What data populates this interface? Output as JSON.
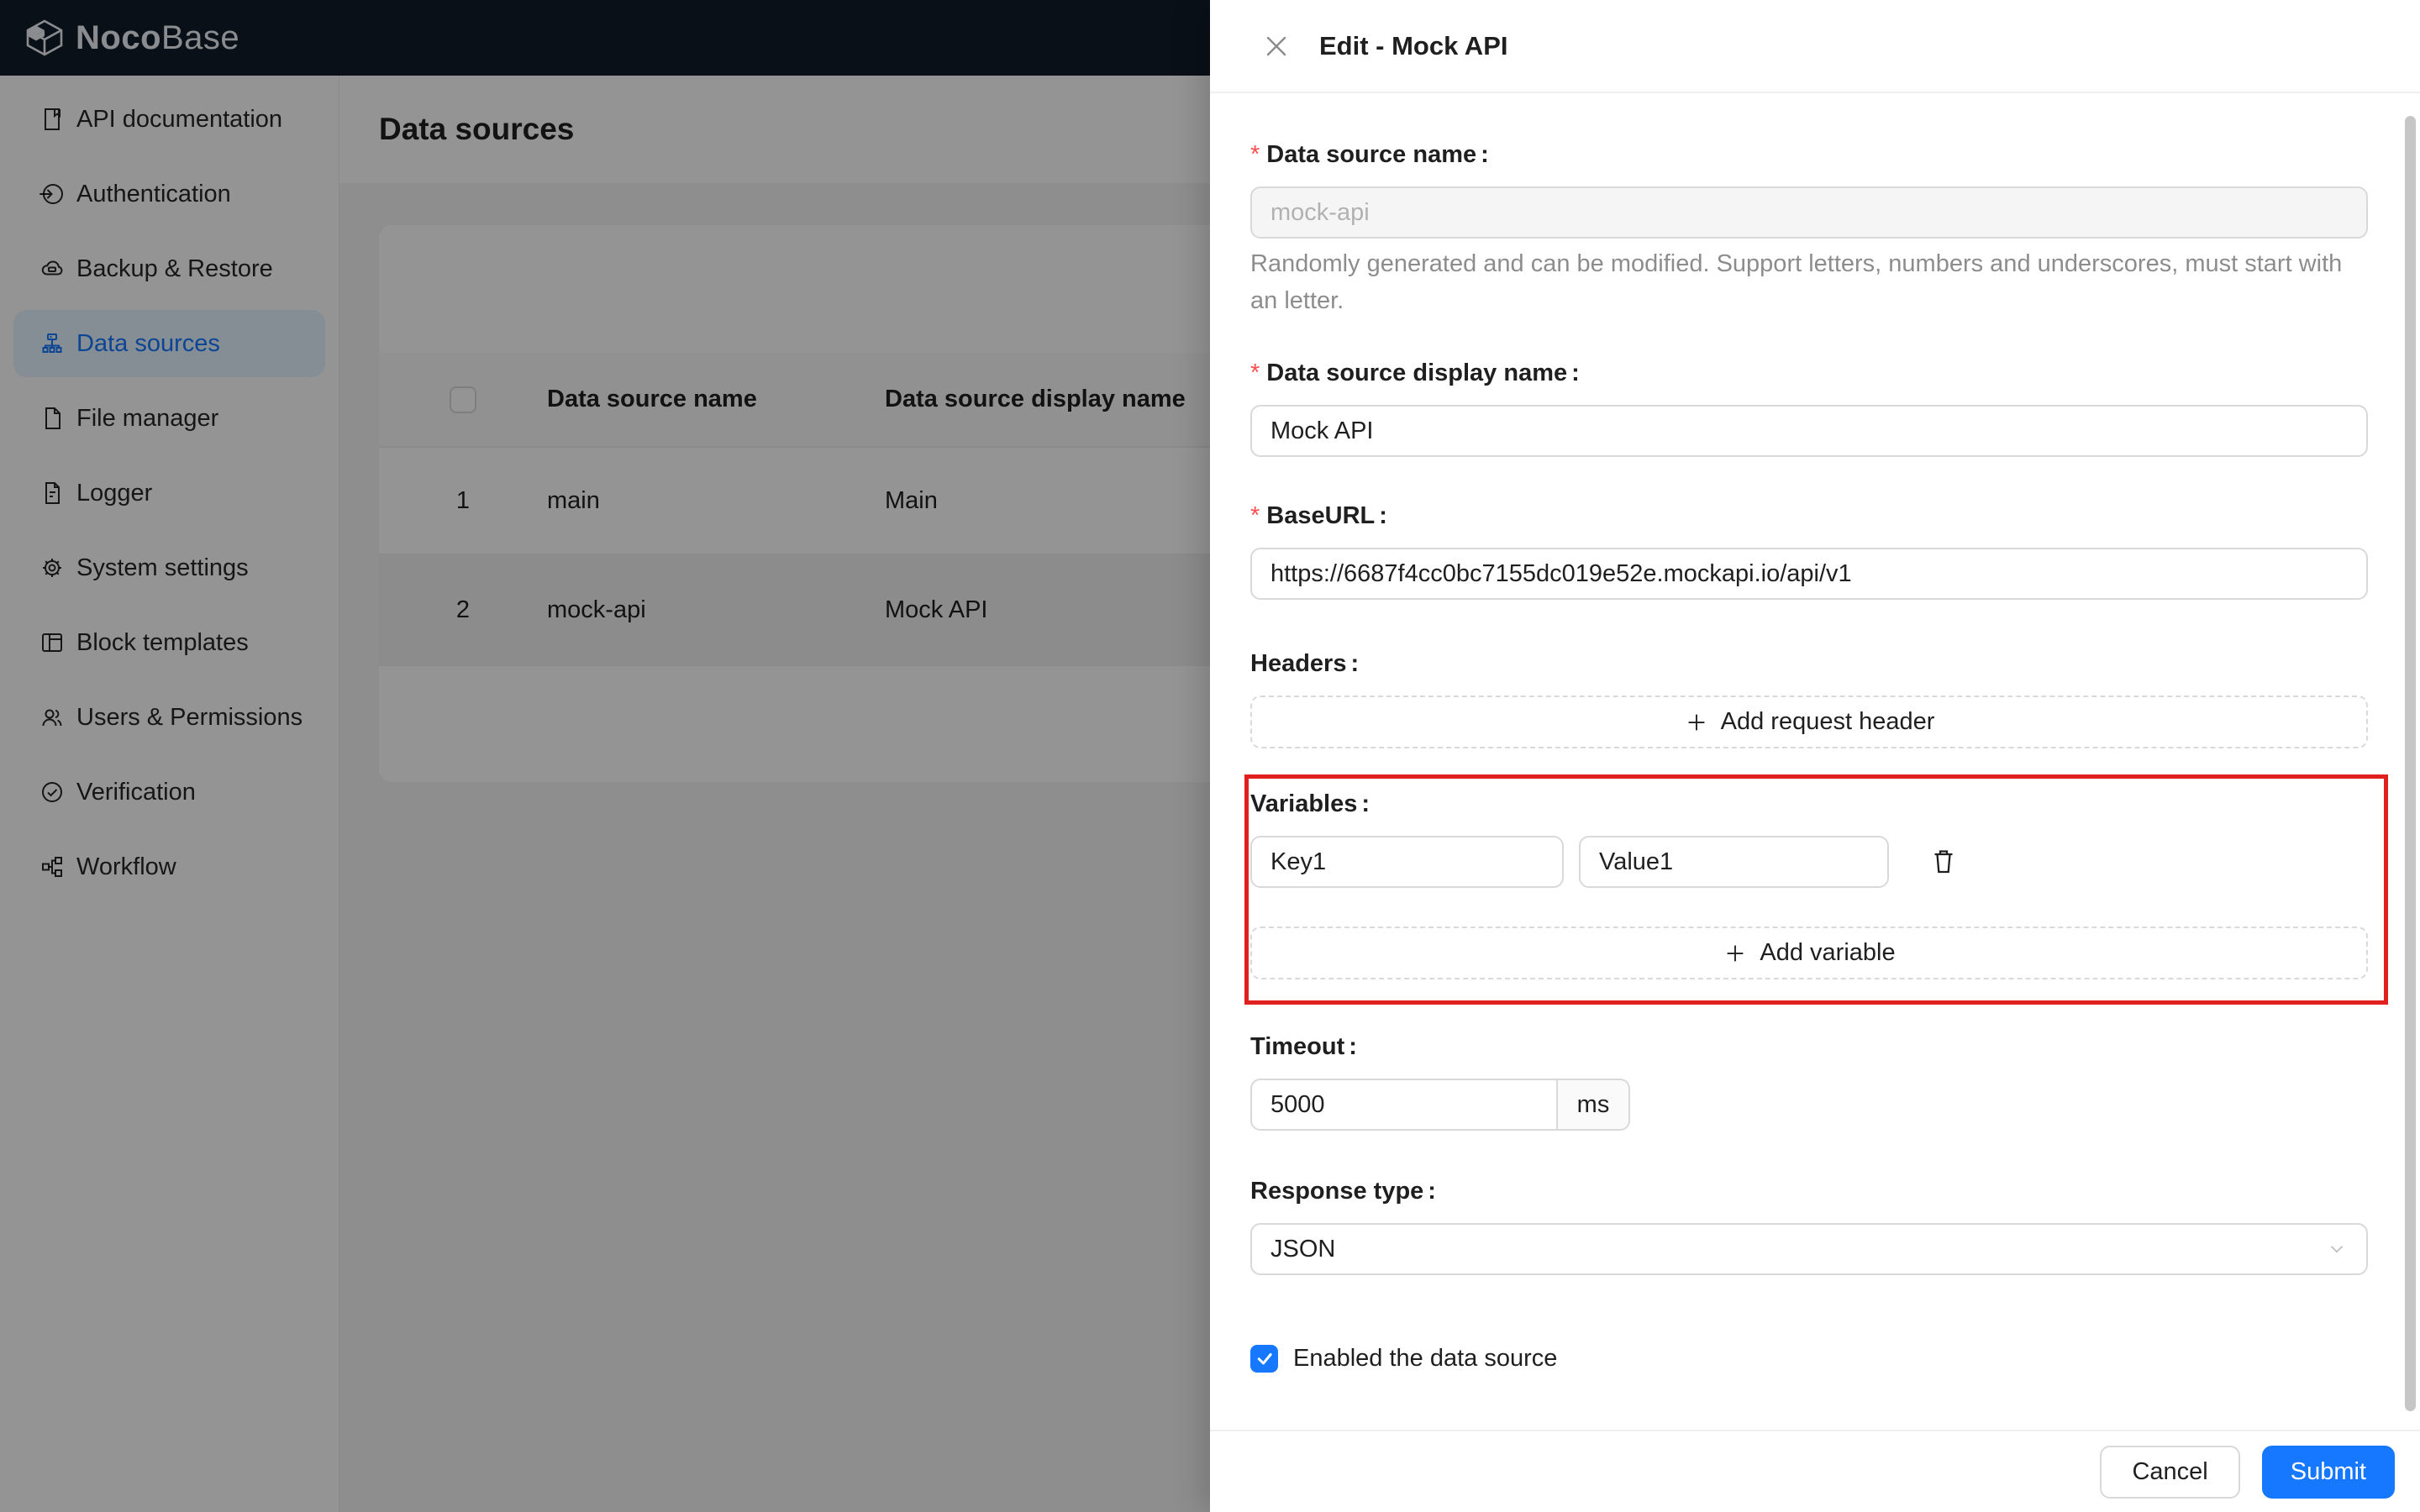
{
  "navbar": {
    "logo_bold": "Noco",
    "logo_light": "Base"
  },
  "page": {
    "title": "Data sources"
  },
  "sidebar": {
    "items": [
      {
        "label": "API documentation",
        "icon": "api-doc-icon",
        "active": false
      },
      {
        "label": "Authentication",
        "icon": "login-icon",
        "active": false
      },
      {
        "label": "Backup & Restore",
        "icon": "cloud-server-icon",
        "active": false
      },
      {
        "label": "Data sources",
        "icon": "cluster-icon",
        "active": true
      },
      {
        "label": "File manager",
        "icon": "file-icon",
        "active": false
      },
      {
        "label": "Logger",
        "icon": "file-text-icon",
        "active": false
      },
      {
        "label": "System settings",
        "icon": "gear-icon",
        "active": false
      },
      {
        "label": "Block templates",
        "icon": "layout-icon",
        "active": false
      },
      {
        "label": "Users & Permissions",
        "icon": "team-icon",
        "active": false
      },
      {
        "label": "Verification",
        "icon": "check-circle-icon",
        "active": false
      },
      {
        "label": "Workflow",
        "icon": "partition-icon",
        "active": false
      }
    ]
  },
  "table": {
    "headers": [
      "Data source name",
      "Data source display name"
    ],
    "rows": [
      {
        "index": "1",
        "name": "main",
        "display": "Main"
      },
      {
        "index": "2",
        "name": "mock-api",
        "display": "Mock API"
      }
    ]
  },
  "drawer": {
    "title": "Edit - Mock API",
    "required_mark": "*",
    "colon": ":",
    "fields": {
      "name": {
        "label": "Data source name",
        "value": "mock-api",
        "help": "Randomly generated and can be modified. Support letters, numbers and underscores, must start with an letter."
      },
      "display_name": {
        "label": "Data source display name",
        "value": "Mock API"
      },
      "base_url": {
        "label": "BaseURL",
        "value": "https://6687f4cc0bc7155dc019e52e.mockapi.io/api/v1"
      },
      "headers": {
        "label": "Headers",
        "add_label": "Add request header"
      },
      "variables": {
        "label": "Variables",
        "rows": [
          {
            "key": "Key1",
            "value": "Value1"
          }
        ],
        "add_label": "Add variable"
      },
      "timeout": {
        "label": "Timeout",
        "value": "5000",
        "addon": "ms"
      },
      "response_type": {
        "label": "Response type",
        "value": "JSON"
      },
      "enabled": {
        "label": "Enabled the data source",
        "checked": true
      }
    },
    "footer": {
      "cancel_label": "Cancel",
      "submit_label": "Submit"
    }
  },
  "colors": {
    "accent": "#1677ff",
    "required": "#ff4d4f",
    "annotation_red": "#e01f1f",
    "navbar_bg": "#111c29",
    "active_item_bg": "#e6f4ff"
  }
}
